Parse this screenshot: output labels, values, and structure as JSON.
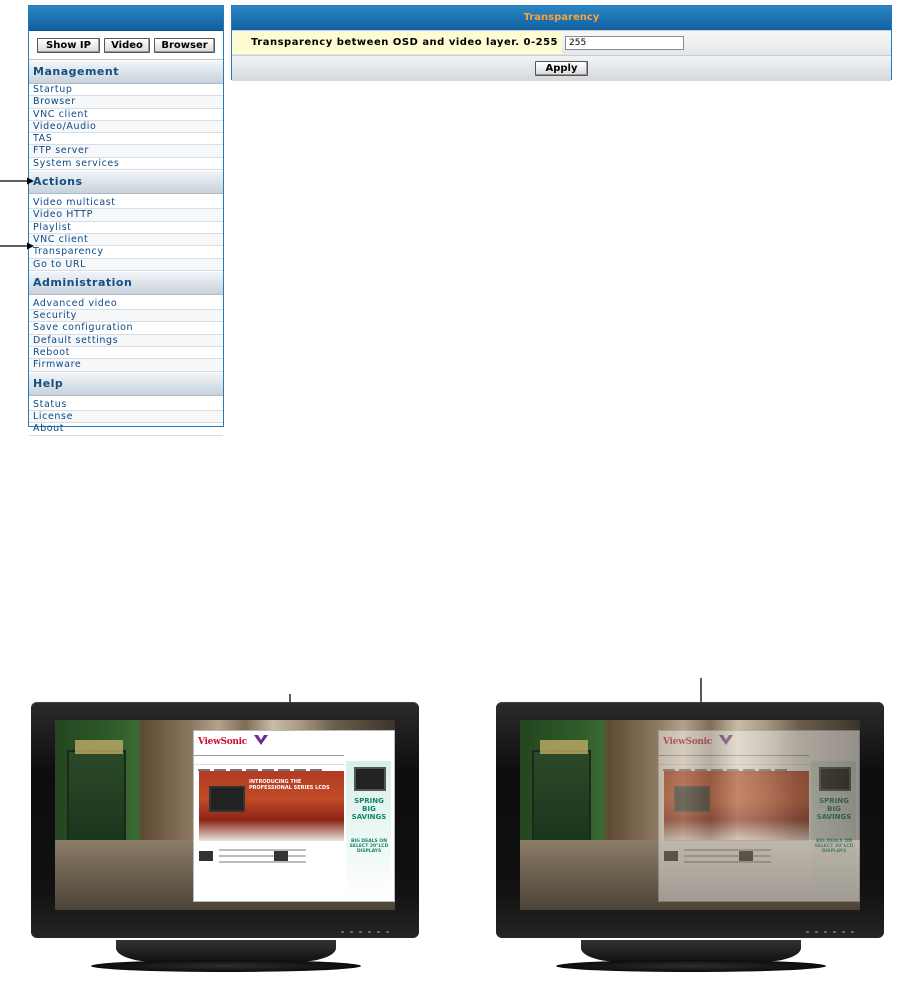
{
  "sidebar": {
    "buttons": [
      "Show IP",
      "Video",
      "Browser"
    ],
    "sections": [
      {
        "title": "Management",
        "items": [
          "Startup",
          "Browser",
          "VNC client",
          "Video/Audio",
          "TAS",
          "FTP server",
          "System services"
        ]
      },
      {
        "title": "Actions",
        "items": [
          "Video multicast",
          "Video HTTP",
          "Playlist",
          "VNC client",
          "Transparency",
          "Go to URL"
        ]
      },
      {
        "title": "Administration",
        "items": [
          "Advanced video",
          "Security",
          "Save configuration",
          "Default settings",
          "Reboot",
          "Firmware"
        ]
      },
      {
        "title": "Help",
        "items": [
          "Status",
          "License",
          "About"
        ]
      }
    ]
  },
  "panel": {
    "title": "Transparency",
    "label": "Transparency between OSD and video layer. 0-255",
    "value": "255",
    "apply_label": "Apply"
  },
  "monitors": {
    "left": {
      "logo": "ViewSonic",
      "hero_text": "INTRODUCING THE PROFESSIONAL SERIES LCDS",
      "promo": "SPRING BIG SAVINGS",
      "promo2": "BIG DEALS ON SELECT 20\"LCD DISPLAYS",
      "overlay_opacity": 1.0
    },
    "right": {
      "logo": "ViewSonic",
      "promo": "SPRING BIG SAVINGS",
      "promo2": "BIG DEALS ON SELECT 20\"LCD DISPLAYS",
      "overlay_opacity": 0.45
    }
  },
  "colors": {
    "header_blue": "#1a6fb0",
    "panel_title": "#f7a23c",
    "section_text": "#114f86",
    "label_bg": "#fdfcd2"
  }
}
